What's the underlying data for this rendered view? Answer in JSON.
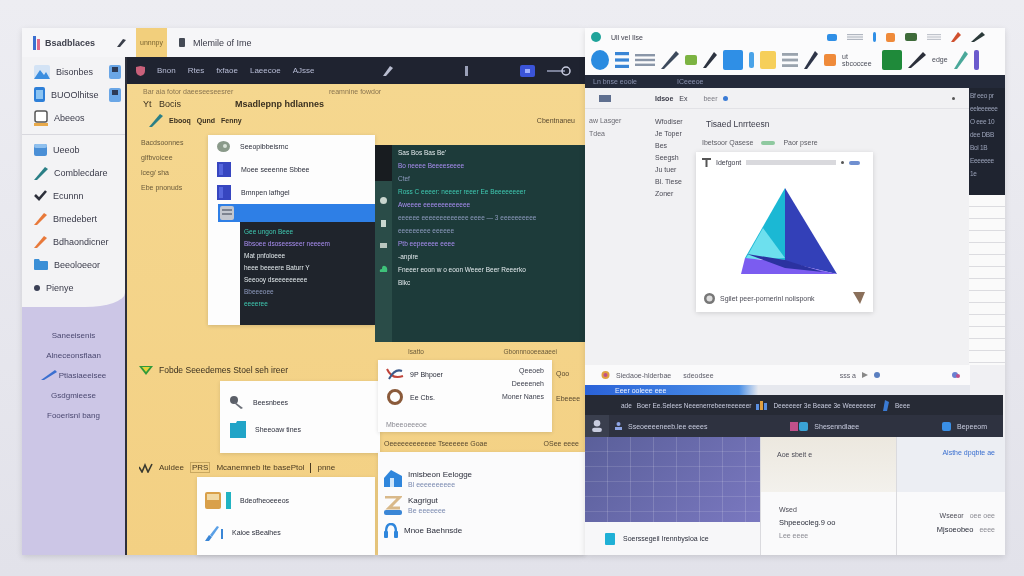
{
  "left_window": {
    "header": {
      "app_name": "Bsadblaces",
      "tabs": [
        {
          "label": "unnnpy",
          "selected": true
        },
        {
          "label": "Mlemile of Ime",
          "selected": false
        }
      ]
    },
    "sidebar": {
      "sections": [
        {
          "items": [
            {
              "label": "Bisonbes",
              "kind": "image",
              "has_thumbnail": true
            },
            {
              "label": "BUOOlhitse",
              "kind": "tablet",
              "has_thumbnail": true
            },
            {
              "label": "Abeeos",
              "kind": "frame",
              "has_thumbnail": false
            }
          ]
        },
        {
          "items": [
            {
              "label": "Ueeob",
              "kind": "cube",
              "has_thumbnail": false
            },
            {
              "label": "Comblecdare",
              "kind": "pen",
              "has_thumbnail": false
            },
            {
              "label": "Ecunnn",
              "kind": "check",
              "has_thumbnail": false
            },
            {
              "label": "Bmedebert",
              "kind": "pencil",
              "has_thumbnail": false
            },
            {
              "label": "Bdhaondicner",
              "kind": "pencil",
              "has_thumbnail": false
            },
            {
              "label": "Beeoloeeor",
              "kind": "folder",
              "has_thumbnail": false
            },
            {
              "label": "Pienye",
              "kind": "dot",
              "has_thumbnail": false
            }
          ]
        }
      ],
      "lower_items": [
        {
          "label": "Saneeisenis",
          "kind": "plain"
        },
        {
          "label": "Alneceonsflaan",
          "kind": "plain"
        },
        {
          "label": "Ptiasiaeeisee",
          "kind": "pen"
        },
        {
          "label": "Gsdgmieese",
          "kind": "plain"
        },
        {
          "label": "Fooerisnl bang",
          "kind": "plain"
        }
      ]
    },
    "nav": {
      "items": [
        "Bnon",
        "Rtes",
        "fxfaoe",
        "Laeecoe",
        "AJsse"
      ]
    },
    "intro": {
      "line": "Bar aia fotor daeeseeseesrer",
      "aside": "reamnine fowdor",
      "label": "Yt",
      "title": "Bocis",
      "heading": "Msadlepnp hdlannes",
      "tags": [
        "Ebooq",
        "Qund",
        "Fenny"
      ],
      "side_note": "Cbentnaneu"
    },
    "notes": [
      "Bacdsoonnes",
      "glfbvoicee",
      "lceg/ sha",
      "Ebe pnonuds"
    ],
    "file_card": {
      "items": [
        {
          "label": "Seeopibbeisrnc",
          "kind": "disk"
        },
        {
          "label": "Moee seeenne Sbbee",
          "kind": "square"
        },
        {
          "label": "Bmnpen lafhgel",
          "kind": "square"
        }
      ],
      "console": [
        {
          "text": "Gee ungon Beee",
          "kind": "accent"
        },
        {
          "text": "Bbsoee dsoseesseer neeeem",
          "kind": "keyword"
        },
        {
          "text": "Mat pnfoloeee",
          "kind": "plain"
        },
        {
          "text": "heee beeeere Baturr Y",
          "kind": "plain"
        },
        {
          "text": "Seeooy dseeeeeeeee",
          "kind": "plain"
        },
        {
          "text": "Bbeeeoee",
          "kind": "muted"
        },
        {
          "text": "eeeeree",
          "kind": "accent"
        }
      ]
    },
    "editor": {
      "lines": [
        {
          "text": "Sas Bos Bas Be'",
          "kind": "plain"
        },
        {
          "text": "Bo neeee Beeeeseeee",
          "kind": "keyword"
        },
        {
          "text": "Ctef",
          "kind": "muted"
        },
        {
          "text": "Ross C eeeer: neeeer reeer Ee Beeeeeeeer",
          "kind": "accent"
        },
        {
          "text": "Aweeee eeeeeeeeeeeee",
          "kind": "keyword"
        },
        {
          "text": "eeeeee eeeeeeeeeeeee eeee — 3 eeeeeeeeee",
          "kind": "muted"
        },
        {
          "text": "eeeeeeeee eeeeee",
          "kind": "muted"
        },
        {
          "text": "Ptb eepeeeee eeee",
          "kind": "keyword"
        },
        {
          "text": "-anpire",
          "kind": "plain"
        },
        {
          "text": "Fneeer eoon w o eoon Weeer Beer Reeerko",
          "kind": "plain"
        },
        {
          "text": "Blkc",
          "kind": "plain"
        }
      ]
    },
    "section_a": {
      "title": "Fobde Seeedemes Stoel seh ireer",
      "items": [
        {
          "label": "Beesnbees",
          "kind": "tools"
        },
        {
          "label": "Sheeoaw tines",
          "kind": "tealfolder"
        }
      ]
    },
    "contact_card": {
      "labels": [
        "Isatto",
        "Gbonnnooeeaaeei"
      ],
      "names": [
        {
          "label": "9P Bhpoer",
          "kind": "swirl"
        },
        {
          "label": "Ee Cbs.",
          "kind": "ring"
        }
      ],
      "values": [
        "Qeeoeb",
        "Deeeeneh",
        "Moner Nanes"
      ],
      "footer": "Mbeeoeeeoe",
      "aside": [
        "Qoo",
        "Ebeeee"
      ],
      "below": [
        "Oeeeeeeeeeeee Tseeeeee Goae",
        "OSee eeee"
      ]
    },
    "section_b": {
      "title": [
        "Auldee",
        "PRS",
        "Mcanemneb lte basePtol",
        "pnne"
      ],
      "items": [
        {
          "label": "Bdeofheoeeeos",
          "kind": "box"
        },
        {
          "label": "Kaioe sBeaihes",
          "kind": "brush"
        }
      ]
    },
    "app_card": {
      "items": [
        {
          "label": "Imisbeon Eelogge",
          "kind": "house",
          "note": "Bl eeeeeeeeee"
        },
        {
          "label": "Kagrigut",
          "kind": "zigzag",
          "note": "Be eeeeeee"
        },
        {
          "label": "Mnoe Baehnsde",
          "kind": "headset"
        }
      ]
    }
  },
  "right_window": {
    "toolbar": {
      "title": "Ull vel Ilse",
      "labels": [
        "ut sbcoccee",
        "edge"
      ]
    },
    "dark_bar": [
      "Ln bnse eoole",
      "ICeeeoe"
    ],
    "explorer": {
      "header": [
        "Idsoe",
        "Ex",
        "beer"
      ],
      "side": [
        "aw Lasger",
        "Tdea"
      ],
      "list": [
        "Wfodiser",
        "Je Toper",
        "Bes",
        "Seegsh",
        "Ju tuer",
        "Bl. Tiese",
        "Zoner"
      ],
      "heading": "Tisaed Lnrrteesn",
      "meta": [
        "Ibetsoor Qasese",
        "Paor psere"
      ],
      "preview": {
        "title": "Idefgont",
        "caption": "Sgilet peer-pornerinl nolisponk"
      }
    },
    "side_strip": [
      "Bf eeo pr",
      "eeleeeeee",
      "O eee 10",
      "dee DBB",
      "Bol 1B",
      "Eeeeeee",
      "1e"
    ],
    "status": [
      "Siedaoe-hlderbae",
      "sdeodsee",
      "sss a"
    ],
    "blue_strip": "Eeer ooleee eee",
    "banner": {
      "line": [
        "ade",
        "Boer Ee.Selees Neeenerrebeereeeeeer",
        "Deeeeeer 3e Beaee 3e Weeeeeeer",
        "Beee"
      ],
      "items": [
        "Sseoeeeeneeb.lee eeees",
        "Shesenndlaee",
        "Bepeeom"
      ]
    },
    "bottom": {
      "file": "Soerssegeil Irennbysloa ice",
      "middle": {
        "top": "Aoe sbeit e",
        "label": "Wsed",
        "value": "Shpeeocleg.9 oo",
        "note": "Lee eeee"
      },
      "right": {
        "link": "Alsthe dpqbte ae",
        "label": "Wseeor",
        "label_note": "oee oee",
        "value": "Mjsoeobeo",
        "value_note": "eeee"
      }
    }
  }
}
